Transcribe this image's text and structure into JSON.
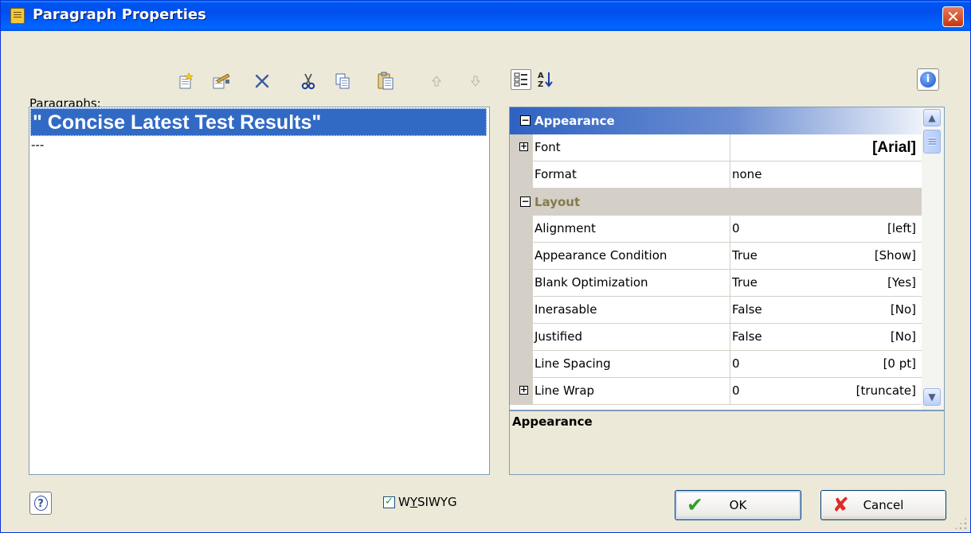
{
  "window": {
    "title": "Paragraph Properties",
    "close_label": "✕"
  },
  "paragraphs": {
    "label_accesskey": "P",
    "label_rest": "aragraphs:",
    "items": [
      "\" Concise Latest Test Results\"",
      "---"
    ]
  },
  "toolbar": {
    "new": "new-paragraph-icon",
    "edit": "edit-paragraph-icon",
    "delete": "delete-icon",
    "cut": "cut-icon",
    "copy": "copy-icon",
    "paste": "paste-icon",
    "move_up": "move-up-icon",
    "move_down": "move-down-icon"
  },
  "properties": {
    "categories": [
      {
        "name": "Appearance",
        "rows": [
          {
            "name": "Font",
            "expandable": true,
            "value": "[Arial]"
          },
          {
            "name": "Format",
            "value": "none"
          }
        ]
      },
      {
        "name": "Layout",
        "rows": [
          {
            "name": "Alignment",
            "value": "0",
            "display": "[left]"
          },
          {
            "name": "Appearance Condition",
            "value": "True",
            "display": "[Show]"
          },
          {
            "name": "Blank Optimization",
            "value": "True",
            "display": "[Yes]"
          },
          {
            "name": "Inerasable",
            "value": "False",
            "display": "[No]"
          },
          {
            "name": "Justified",
            "value": "False",
            "display": "[No]"
          },
          {
            "name": "Line Spacing",
            "value": "0",
            "display": "[0 pt]"
          },
          {
            "name": "Line Wrap",
            "expandable": true,
            "value": "0",
            "display": "[truncate]"
          }
        ]
      }
    ],
    "description_title": "Appearance"
  },
  "footer": {
    "wysiwyg_before": "W",
    "wysiwyg_accesskey": "Y",
    "wysiwyg_after": "SIWYG",
    "wysiwyg_checked": true,
    "ok": "OK",
    "cancel": "Cancel"
  }
}
